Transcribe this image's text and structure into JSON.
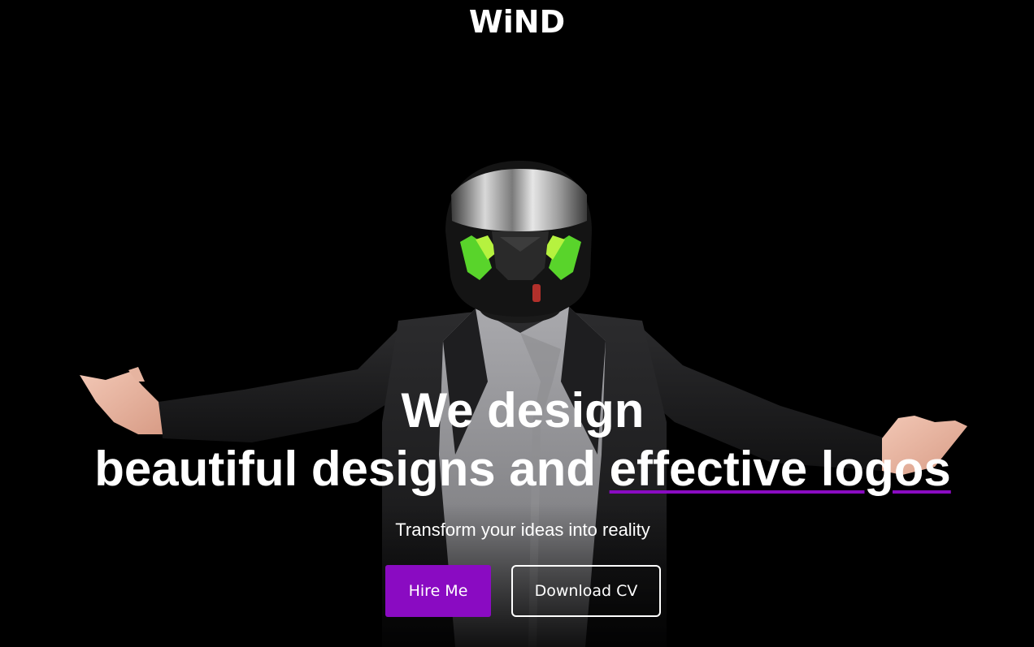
{
  "brand": {
    "logo_text": "WiND"
  },
  "hero": {
    "headline_line1": "We design",
    "headline_line2_prefix": "beautiful designs and ",
    "headline_line2_highlight": "effective logos",
    "tagline": "Transform your ideas into reality"
  },
  "actions": {
    "hire_label": "Hire Me",
    "cv_label": "Download CV"
  },
  "colors": {
    "accent": "#8a0bc2",
    "background": "#000000",
    "text": "#ffffff"
  },
  "icons": {
    "hero_image": "person-in-motorcycle-helmet"
  }
}
